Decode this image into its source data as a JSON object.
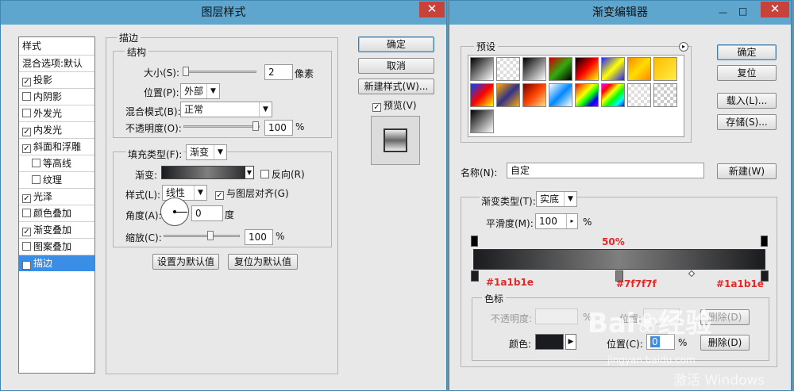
{
  "layer_style": {
    "title": "图层样式",
    "close": "✕",
    "side_header": "样式",
    "side_items": [
      {
        "label": "混合选项:默认",
        "check": false,
        "indent": false,
        "nocheck": true
      },
      {
        "label": "投影",
        "check": true,
        "indent": false
      },
      {
        "label": "内阴影",
        "check": false,
        "indent": false
      },
      {
        "label": "外发光",
        "check": false,
        "indent": false
      },
      {
        "label": "内发光",
        "check": true,
        "indent": false
      },
      {
        "label": "斜面和浮雕",
        "check": true,
        "indent": false
      },
      {
        "label": "等高线",
        "check": false,
        "indent": true
      },
      {
        "label": "纹理",
        "check": false,
        "indent": true
      },
      {
        "label": "光泽",
        "check": true,
        "indent": false
      },
      {
        "label": "颜色叠加",
        "check": false,
        "indent": false
      },
      {
        "label": "渐变叠加",
        "check": true,
        "indent": false
      },
      {
        "label": "图案叠加",
        "check": false,
        "indent": false
      },
      {
        "label": "描边",
        "check": true,
        "indent": false,
        "selected": true
      }
    ],
    "stroke_title": "描边",
    "structure_title": "结构",
    "size_label": "大小(S):",
    "size_value": "2",
    "size_unit": "像素",
    "position_label": "位置(P):",
    "position_value": "外部",
    "blend_label": "混合模式(B):",
    "blend_value": "正常",
    "opacity_label": "不透明度(O):",
    "opacity_value": "100",
    "opacity_unit": "%",
    "fill_type_label": "填充类型(F):",
    "fill_type_value": "渐变",
    "gradient_label": "渐变:",
    "reverse_label": "反向(R)",
    "style_label": "样式(L):",
    "style_value": "线性",
    "align_label": "与图层对齐(G)",
    "angle_label": "角度(A):",
    "angle_value": "0",
    "angle_unit": "度",
    "scale_label": "缩放(C):",
    "scale_value": "100",
    "scale_unit": "%",
    "set_default": "设置为默认值",
    "reset_default": "复位为默认值",
    "ok": "确定",
    "cancel": "取消",
    "new_style": "新建样式(W)...",
    "preview_label": "预览(V)",
    "ok_check": "✓"
  },
  "gradient_editor": {
    "title": "渐变编辑器",
    "presets_label": "预设",
    "menu_icon": "▸",
    "ok": "确定",
    "reset": "复位",
    "load": "载入(L)...",
    "save": "存储(S)...",
    "name_label": "名称(N):",
    "name_value": "自定",
    "new_btn": "新建(W)",
    "type_label": "渐变类型(T):",
    "type_value": "实底",
    "smooth_label": "平滑度(M):",
    "smooth_value": "100",
    "smooth_unit": "%",
    "midpoint_pct": "50%",
    "stop_left": "#1a1b1e",
    "stop_mid": "#7f7f7f",
    "stop_right": "#1a1b1e",
    "stops_title": "色标",
    "stop_opacity_label": "不透明度:",
    "stop_opacity_unit": "%",
    "location_label": "位置:",
    "delete_label": "删除(D)",
    "color_label": "颜色:",
    "color_location_label": "位置(C):",
    "color_location_value": "0",
    "color_location_unit": "%",
    "color_delete": "删除(D)",
    "win_min": "—",
    "win_max": "□",
    "win_close": "✕"
  },
  "watermark": {
    "brand": "Bai",
    "brand2": "经验",
    "url": "jingyan.baidu.com",
    "activate": "激活 Windows"
  }
}
